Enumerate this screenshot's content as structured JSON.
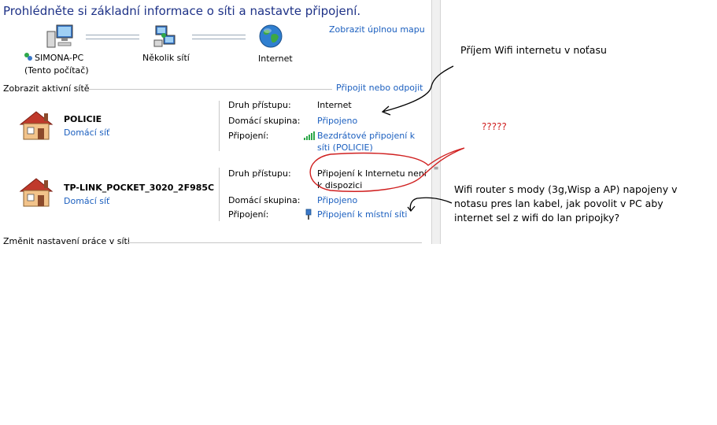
{
  "header": {
    "title": "Prohlédněte si základní informace o síti a nastavte připojení.",
    "full_map_link": "Zobrazit úplnou mapu"
  },
  "map": {
    "computer_name": "SIMONA-PC",
    "computer_sub": "(Tento počítač)",
    "networks_label": "Několik sítí",
    "internet_label": "Internet"
  },
  "active_networks": {
    "section_label": "Zobrazit aktivní sítě",
    "connect_link": "Připojit nebo odpojit"
  },
  "network1": {
    "name": "POLICIE",
    "type": "Domácí síť",
    "access_label": "Druh přístupu:",
    "access_value": "Internet",
    "homegroup_label": "Domácí skupina:",
    "homegroup_value": "Připojeno",
    "connections_label": "Připojení:",
    "connections_value_1": "Bezdrátové připojení k",
    "connections_value_2": "síti (POLICIE)"
  },
  "network2": {
    "name": "TP-LINK_POCKET_3020_2F985C",
    "type": "Domácí síť",
    "access_label": "Druh přístupu:",
    "access_value_1": "Připojení k Internetu není",
    "access_value_2": "k dispozici",
    "homegroup_label": "Domácí skupina:",
    "homegroup_value": "Připojeno",
    "connections_label": "Připojení:",
    "connections_value": "Připojení k místní síti"
  },
  "bottom": {
    "change_settings": "Změnit nastavení práce v síti"
  },
  "annotations": {
    "wifi_note": "Příjem Wifi internetu v noťasu",
    "question": "?????",
    "router_note_1": "Wifi router s mody (3g,Wisp a AP) napojeny v",
    "router_note_2": "notasu pres lan kabel, jak povolit v PC aby",
    "router_note_3": "internet sel z wifi do lan pripojky?"
  },
  "colors": {
    "title": "#1e3287",
    "link": "#1b5fbf",
    "annotation_red": "#d02020"
  }
}
